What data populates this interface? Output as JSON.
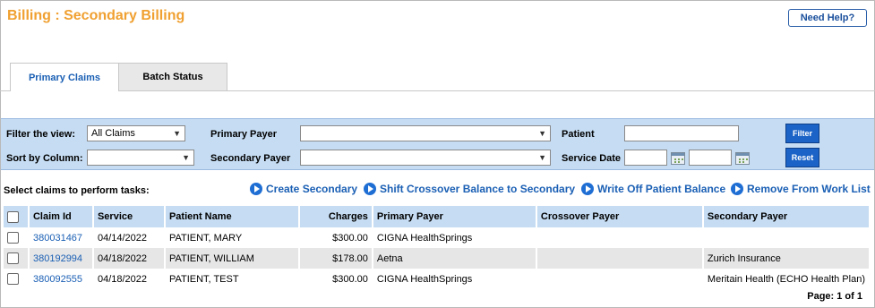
{
  "page": {
    "title": "Billing : Secondary Billing",
    "help_label": "Need Help?"
  },
  "tabs": [
    {
      "label": "Primary Claims",
      "active": true
    },
    {
      "label": "Batch Status",
      "active": false
    }
  ],
  "filters": {
    "filter_view_label": "Filter the view:",
    "filter_view_value": "All Claims",
    "sort_label": "Sort by Column:",
    "sort_value": "",
    "primary_payer_label": "Primary Payer",
    "primary_payer_value": "",
    "secondary_payer_label": "Secondary Payer",
    "secondary_payer_value": "",
    "patient_label": "Patient",
    "patient_value": "",
    "service_date_label": "Service Date",
    "service_date_from": "",
    "service_date_to": "",
    "filter_button": "Filter",
    "reset_button": "Reset"
  },
  "tasks": {
    "label": "Select claims to perform tasks:",
    "actions": [
      "Create Secondary",
      "Shift Crossover Balance to Secondary",
      "Write Off Patient Balance",
      "Remove From Work List"
    ]
  },
  "table": {
    "columns": [
      "Claim Id",
      "Service",
      "Patient Name",
      "Charges",
      "Primary Payer",
      "Crossover Payer",
      "Secondary Payer"
    ],
    "rows": [
      {
        "claim_id": "380031467",
        "service": "04/14/2022",
        "patient": "PATIENT, MARY",
        "charges": "$300.00",
        "primary_payer": "CIGNA HealthSprings",
        "crossover_payer": "",
        "secondary_payer": ""
      },
      {
        "claim_id": "380192994",
        "service": "04/18/2022",
        "patient": "PATIENT, WILLIAM",
        "charges": "$178.00",
        "primary_payer": "Aetna",
        "crossover_payer": "",
        "secondary_payer": "Zurich Insurance"
      },
      {
        "claim_id": "380092555",
        "service": "04/18/2022",
        "patient": "PATIENT, TEST",
        "charges": "$300.00",
        "primary_payer": "CIGNA HealthSprings",
        "crossover_payer": "",
        "secondary_payer": "Meritain Health (ECHO Health Plan)"
      }
    ]
  },
  "pager": "Page: 1 of 1",
  "colors": {
    "title": "#f0a030",
    "link": "#1a5fb4",
    "panel": "#c5dcf2",
    "button": "#1b63c6"
  }
}
